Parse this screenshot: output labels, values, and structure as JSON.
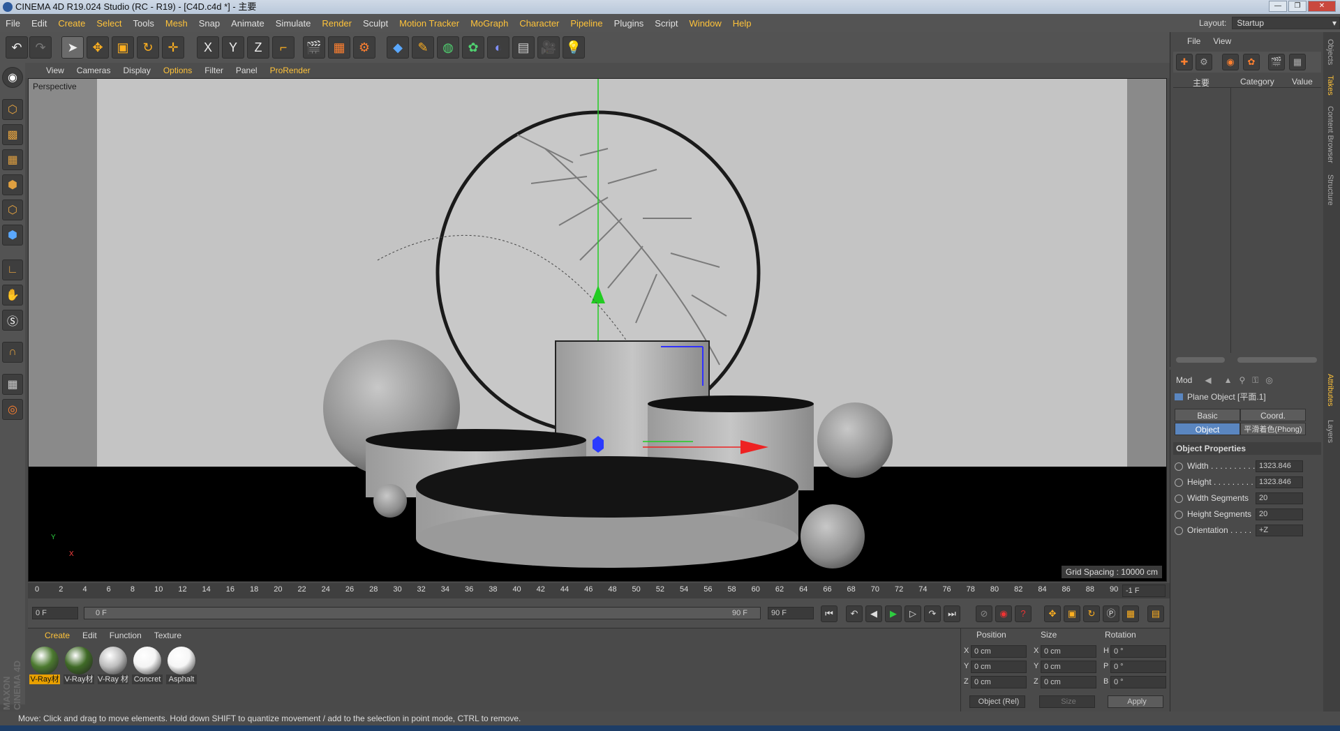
{
  "window": {
    "title": "CINEMA 4D R19.024 Studio (RC - R19) - [C4D.c4d *] - 主要",
    "controls": [
      "—",
      "❐",
      "✕"
    ]
  },
  "menu": {
    "items": [
      "File",
      "Edit",
      "Create",
      "Select",
      "Tools",
      "Mesh",
      "Snap",
      "Animate",
      "Simulate",
      "Render",
      "Sculpt",
      "Motion Tracker",
      "MoGraph",
      "Character",
      "Pipeline",
      "Plugins",
      "Script",
      "Window",
      "Help"
    ],
    "layout_label": "Layout:",
    "layout_value": "Startup"
  },
  "toolbar": {
    "axis_x": "X",
    "axis_y": "Y",
    "axis_z": "Z"
  },
  "viewport_menu": {
    "items": [
      "View",
      "Cameras",
      "Display",
      "Options",
      "Filter",
      "Panel",
      "ProRender"
    ],
    "label": "Perspective",
    "grid_spacing": "Grid Spacing : 10000 cm",
    "axis_y": "Y",
    "axis_x": "X"
  },
  "timeline": {
    "ticks": [
      "0",
      "2",
      "4",
      "6",
      "8",
      "10",
      "12",
      "14",
      "16",
      "18",
      "20",
      "22",
      "24",
      "26",
      "28",
      "30",
      "32",
      "34",
      "36",
      "38",
      "40",
      "42",
      "44",
      "46",
      "48",
      "50",
      "52",
      "54",
      "56",
      "58",
      "60",
      "62",
      "64",
      "66",
      "68",
      "70",
      "72",
      "74",
      "76",
      "78",
      "80",
      "82",
      "84",
      "86",
      "88",
      "90"
    ],
    "end_field": "-1 F"
  },
  "transport": {
    "current_frame": "0 F",
    "range_start": "0 F",
    "range_end": "90 F",
    "max_frame": "90 F"
  },
  "materials": {
    "menu": [
      "Create",
      "Edit",
      "Function",
      "Texture"
    ],
    "items": [
      {
        "label": "V-Ray材",
        "color": "#4c7a30",
        "selected": true
      },
      {
        "label": "V-Ray材",
        "color": "#3f6a26",
        "selected": false
      },
      {
        "label": "V-Ray 材",
        "color": "#bdbdbd",
        "selected": false
      },
      {
        "label": "Concret",
        "color": "#f4f4f4",
        "selected": false
      },
      {
        "label": "Asphalt",
        "color": "#f6f6f6",
        "selected": false
      }
    ]
  },
  "coordinates": {
    "headers": [
      "Position",
      "Size",
      "Rotation"
    ],
    "rows": [
      {
        "pos_axis": "X",
        "pos": "0 cm",
        "size_axis": "X",
        "size": "0 cm",
        "rot_axis": "H",
        "rot": "0 °"
      },
      {
        "pos_axis": "Y",
        "pos": "0 cm",
        "size_axis": "Y",
        "size": "0 cm",
        "rot_axis": "P",
        "rot": "0 °"
      },
      {
        "pos_axis": "Z",
        "pos": "0 cm",
        "size_axis": "Z",
        "size": "0 cm",
        "rot_axis": "B",
        "rot": "0 °"
      }
    ],
    "mode": "Object (Rel)",
    "size_mode": "Size",
    "apply": "Apply"
  },
  "objects_panel": {
    "menu": [
      "File",
      "View"
    ],
    "col_name": "主要",
    "col_category": "Category",
    "col_value": "Value"
  },
  "attributes": {
    "mode": "Mod",
    "object_title": "Plane Object [平面.1]",
    "tabs": [
      "Basic",
      "Coord.",
      "Object",
      "平滑着色(Phong)"
    ],
    "section": "Object Properties",
    "props": [
      {
        "name": "Width . . . . . . . . . . .",
        "value": "1323.846"
      },
      {
        "name": "Height . . . . . . . . . .",
        "value": "1323.846"
      },
      {
        "name": "Width Segments",
        "value": "20"
      },
      {
        "name": "Height Segments",
        "value": "20"
      },
      {
        "name": "Orientation . . . . .",
        "value": "+Z"
      }
    ]
  },
  "side_tabs": [
    "Objects",
    "Takes",
    "Content Browser",
    "Structure",
    "Attributes",
    "Layers"
  ],
  "status": "Move: Click and drag to move elements. Hold down SHIFT to quantize movement / add to the selection in point mode, CTRL to remove.",
  "brand": "MAXON CINEMA 4D"
}
